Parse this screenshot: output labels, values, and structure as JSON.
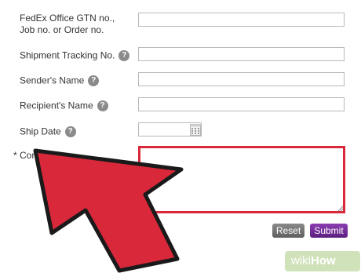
{
  "form": {
    "gtn_label_line1": "FedEx Office GTN no.,",
    "gtn_label_line2": "Job no. or Order no.",
    "tracking_label": "Shipment Tracking No.",
    "sender_label": "Sender's Name",
    "recipient_label": "Recipient's Name",
    "ship_date_label": "Ship Date",
    "required_marker": "*",
    "comments_label": "Comments",
    "help_glyph": "?",
    "gtn_value": "",
    "tracking_value": "",
    "sender_value": "",
    "recipient_value": "",
    "ship_date_value": "",
    "comments_value": ""
  },
  "buttons": {
    "reset_label": "Reset",
    "submit_label": "Submit"
  },
  "icons": {
    "help": "question-circle-icon",
    "calendar": "calendar-icon",
    "resize": "resize-grip-icon",
    "pointer": "arrow-icon"
  },
  "colors": {
    "highlight": "#d8283a",
    "arrow": "#d8283a",
    "submit": "#6a2a90",
    "reset": "#7a7a7a",
    "help_icon": "#8a8a8a"
  },
  "watermark": {
    "part1": "wiki",
    "part2": "How"
  }
}
